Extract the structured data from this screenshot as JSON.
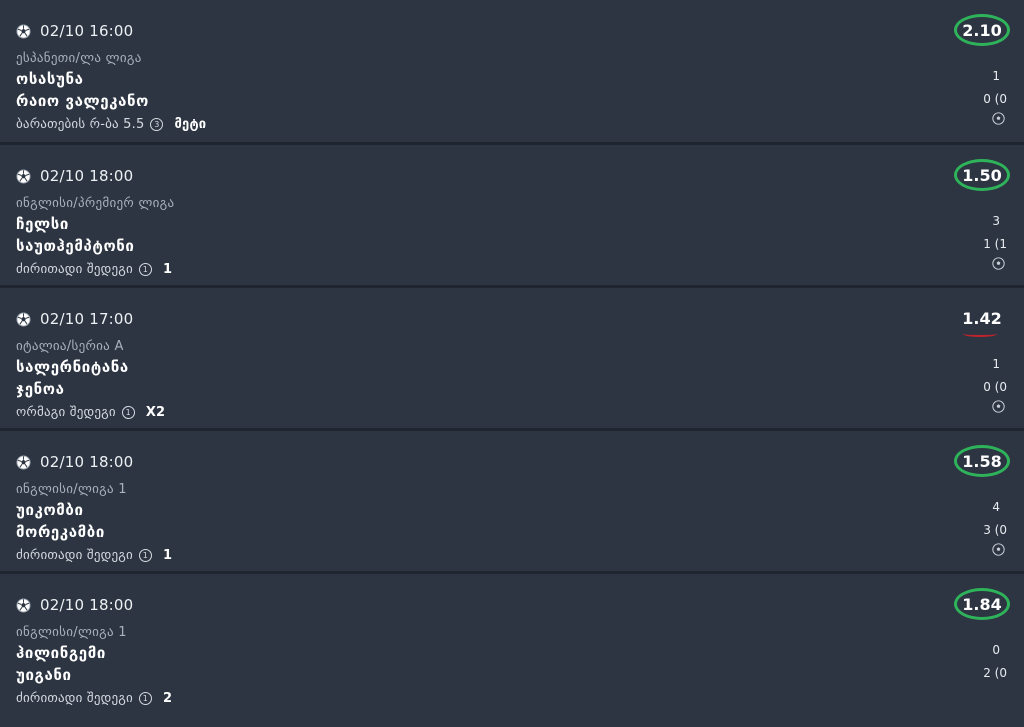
{
  "matches": [
    {
      "date": "02/10 16:00",
      "league": "ესპანეთი/ლა ლიგა",
      "home": "ოსასუნა",
      "away": "რაიო ვალეკანო",
      "market": "ბარათების რ-ბა 5.5",
      "market_num": "3",
      "pick": "მეტი",
      "odds": "2.10",
      "odds_status": "won",
      "score_home": "1",
      "score_away": "0 (0"
    },
    {
      "date": "02/10 18:00",
      "league": "ინგლისი/პრემიერ ლიგა",
      "home": "ჩელსი",
      "away": "საუთჰემპტონი",
      "market": "ძირითადი შედეგი",
      "market_num": "1",
      "pick": "1",
      "odds": "1.50",
      "odds_status": "won",
      "score_home": "3",
      "score_away": "1 (1"
    },
    {
      "date": "02/10 17:00",
      "league": "იტალია/სერია A",
      "home": "სალერნიტანა",
      "away": "ჯენოა",
      "market": "ორმაგი შედეგი",
      "market_num": "1",
      "pick": "X2",
      "odds": "1.42",
      "odds_status": "lost",
      "score_home": "1",
      "score_away": "0 (0"
    },
    {
      "date": "02/10 18:00",
      "league": "ინგლისი/ლიგა 1",
      "home": "უიკომბი",
      "away": "მორეკამბი",
      "market": "ძირითადი შედეგი",
      "market_num": "1",
      "pick": "1",
      "odds": "1.58",
      "odds_status": "won",
      "score_home": "4",
      "score_away": "3 (0"
    },
    {
      "date": "02/10 18:00",
      "league": "ინგლისი/ლიგა 1",
      "home": "ჰილინგემი",
      "away": "უიგანი",
      "market": "ძირითადი შედეგი",
      "market_num": "1",
      "pick": "2",
      "odds": "1.84",
      "odds_status": "won",
      "score_home": "0",
      "score_away": "2 (0"
    }
  ],
  "icons": {
    "sport": "soccer-ball-icon",
    "live": "soccer-ball-icon",
    "info": "circled-number-icon"
  },
  "colors": {
    "background": "#2c3541",
    "won_ring": "#2fb35a",
    "lost_mark": "#c0232c",
    "divider": "#1f262f"
  }
}
